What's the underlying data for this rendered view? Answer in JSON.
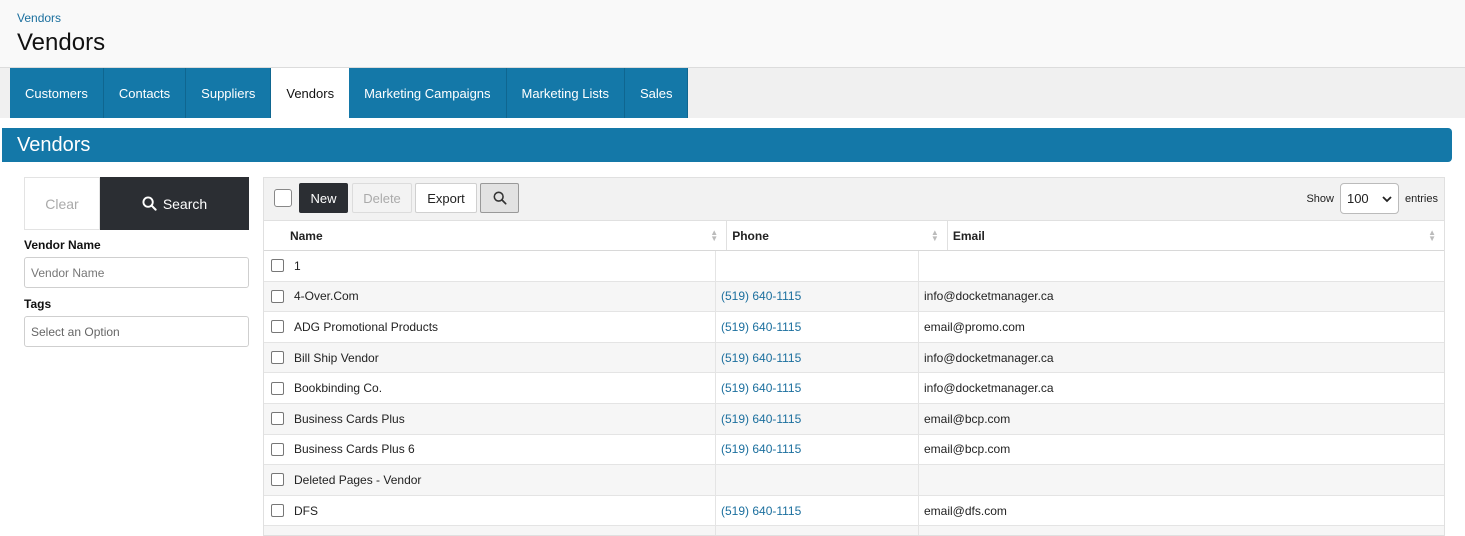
{
  "header": {
    "breadcrumb": "Vendors",
    "title": "Vendors"
  },
  "tabs": [
    {
      "label": "Customers",
      "active": false
    },
    {
      "label": "Contacts",
      "active": false
    },
    {
      "label": "Suppliers",
      "active": false
    },
    {
      "label": "Vendors",
      "active": true
    },
    {
      "label": "Marketing Campaigns",
      "active": false
    },
    {
      "label": "Marketing Lists",
      "active": false
    },
    {
      "label": "Sales",
      "active": false
    }
  ],
  "section": {
    "title": "Vendors"
  },
  "filter": {
    "clear_label": "Clear",
    "search_label": "Search",
    "vendor_name_label": "Vendor Name",
    "vendor_name_placeholder": "Vendor Name",
    "tags_label": "Tags",
    "tags_placeholder": "Select an Option"
  },
  "toolbar": {
    "new_label": "New",
    "delete_label": "Delete",
    "export_label": "Export",
    "show_label": "Show",
    "show_value": "100",
    "entries_label": "entries"
  },
  "table": {
    "columns": [
      "Name",
      "Phone",
      "Email"
    ],
    "rows": [
      {
        "name": "1",
        "phone": "",
        "email": ""
      },
      {
        "name": "4-Over.Com",
        "phone": "(519) 640-1115",
        "email": "info@docketmanager.ca"
      },
      {
        "name": "ADG Promotional Products",
        "phone": "(519) 640-1115",
        "email": "email@promo.com"
      },
      {
        "name": "Bill Ship Vendor",
        "phone": "(519) 640-1115",
        "email": "info@docketmanager.ca"
      },
      {
        "name": "Bookbinding Co.",
        "phone": "(519) 640-1115",
        "email": "info@docketmanager.ca"
      },
      {
        "name": "Business Cards Plus",
        "phone": "(519) 640-1115",
        "email": "email@bcp.com"
      },
      {
        "name": "Business Cards Plus 6",
        "phone": "(519) 640-1115",
        "email": "email@bcp.com"
      },
      {
        "name": "Deleted Pages - Vendor",
        "phone": "",
        "email": ""
      },
      {
        "name": "DFS",
        "phone": "(519) 640-1115",
        "email": "email@dfs.com"
      },
      {
        "name": "",
        "phone": "",
        "email": ""
      }
    ]
  },
  "colors": {
    "accent": "#1478a8",
    "dark_button": "#2b2e33",
    "link": "#1b6f9e"
  }
}
